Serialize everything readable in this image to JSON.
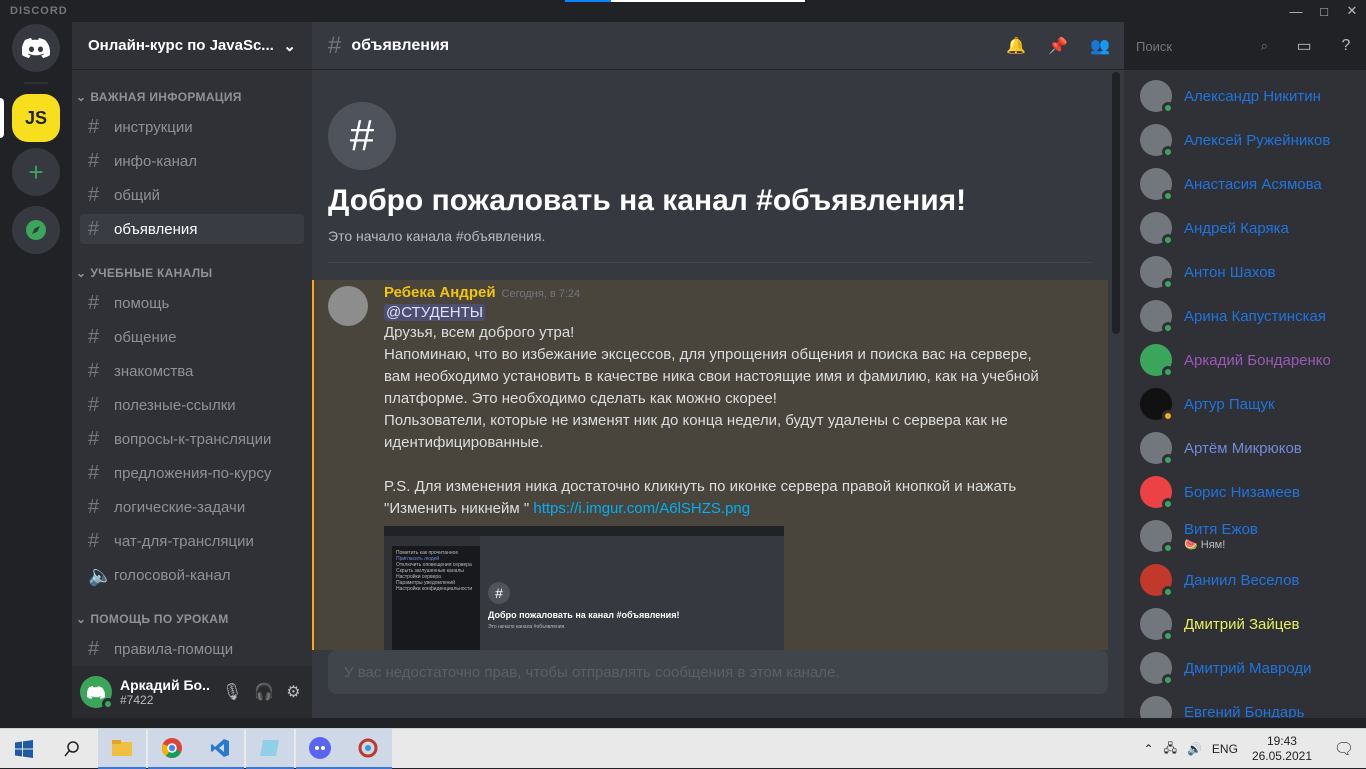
{
  "window": {
    "brand": "DISCORD",
    "controls": [
      "—",
      "□",
      "✕"
    ]
  },
  "server": {
    "name": "Онлайн-курс по JavaSc...",
    "js_label": "JS"
  },
  "categories": [
    {
      "label": "ВАЖНАЯ ИНФОРМАЦИЯ"
    },
    {
      "label": "УЧЕБНЫЕ КАНАЛЫ"
    },
    {
      "label": "ПОМОЩЬ ПО УРОКАМ"
    }
  ],
  "channels": [
    "инструкции",
    "инфо-канал",
    "общий",
    "объявления",
    "помощь",
    "общение",
    "знакомства",
    "полезные-ссылки",
    "вопросы-к-трансляции",
    "предложения-по-курсу",
    "логические-задачи",
    "чат-для-трансляции",
    "голосовой-канал",
    "правила-помощи"
  ],
  "user": {
    "name": "Аркадий Бо...",
    "tag": "#7422"
  },
  "header": {
    "channel": "объявления",
    "search_placeholder": "Поиск"
  },
  "welcome": {
    "icon": "#",
    "title": "Добро пожаловать на канал #объявления!",
    "subtitle": "Это начало канала #объявления."
  },
  "message": {
    "author": "Ребека Андрей",
    "time": "Сегодня, в 7:24",
    "mention": "@СТУДЕНТЫ",
    "lines": [
      "Друзья, всем доброго утра!",
      "Напоминаю, что во избежание эксцессов, для упрощения общения и поиска вас на сервере,",
      "вам необходимо установить в качестве ника свои настоящие имя и фамилию, как на учебной",
      "платформе. Это необходимо сделать как можно скорее!",
      "Пользователи, которые не изменят ник до конца недели, будут удалены с сервера как не",
      "идентифицированные.",
      "",
      "P.S. Для изменения ника достаточно кликнуть по иконке сервера правой кнопкой и нажать"
    ],
    "last_line": "\"Изменить никнейм \" ",
    "link": "https://i.imgur.com/A6lSHZS.png",
    "embed": {
      "title": "Добро пожаловать на канал #объявления!",
      "subtitle": "Это начало канала #объявления.",
      "hash": "#",
      "menu": [
        "Пометить как прочитанное",
        "Пригласить людей",
        "Отключить оповещения сервера",
        "Скрыть заглушенные каналы",
        "Настройки сервера",
        "Параметры уведомлений",
        "Настройки конфиденциальности"
      ]
    }
  },
  "composer": {
    "placeholder": "У вас недостаточно прав, чтобы отправлять сообщения в этом канале."
  },
  "members": [
    {
      "name": "Александр Никитин",
      "color": "#1f74df"
    },
    {
      "name": "Алексей Ружейников",
      "color": "#1f74df"
    },
    {
      "name": "Анастасия Асямова",
      "color": "#1f74df"
    },
    {
      "name": "Андрей Каряка",
      "color": "#1f74df"
    },
    {
      "name": "Антон Шахов",
      "color": "#1f74df"
    },
    {
      "name": "Арина Капустинская",
      "color": "#1f74df"
    },
    {
      "name": "Аркадий Бондаренко",
      "color": "#9b59b6"
    },
    {
      "name": "Артур Пащук",
      "color": "#1f74df"
    },
    {
      "name": "Артём Микрюков",
      "color": "#7289da"
    },
    {
      "name": "Борис Низамеев",
      "color": "#1f74df"
    },
    {
      "name": "Витя Ежов",
      "color": "#1f74df",
      "activity": "🍉 Ням!"
    },
    {
      "name": "Даниил Веселов",
      "color": "#1f74df"
    },
    {
      "name": "Дмитрий Зайцев",
      "color": "#e8f05a"
    },
    {
      "name": "Дмитрий Мавроди",
      "color": "#1f74df"
    },
    {
      "name": "Евгений Бондарь",
      "color": "#1f74df"
    }
  ],
  "taskbar": {
    "lang": "ENG",
    "time": "19:43",
    "date": "26.05.2021"
  }
}
